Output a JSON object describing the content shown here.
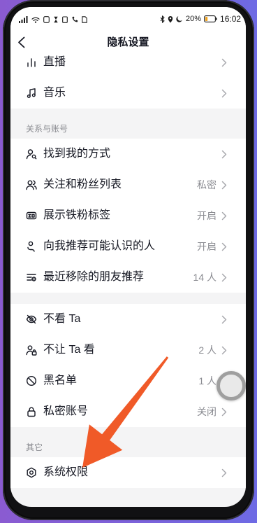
{
  "status_bar": {
    "battery": "20%",
    "time": "16:02",
    "icons_left": [
      "signal-icon",
      "wifi-icon",
      "message-icon",
      "hourglass-icon",
      "clipboard-icon",
      "call-icon",
      "sim-icon"
    ],
    "icons_right": [
      "bluetooth-icon",
      "location-icon",
      "moon-icon",
      "battery-icon"
    ]
  },
  "header": {
    "title": "隐私设置",
    "back_icon": "chevron-left-icon"
  },
  "groups": [
    {
      "items": [
        {
          "label": "直播",
          "icon": "live-bars-icon"
        },
        {
          "label": "音乐",
          "icon": "music-note-icon"
        }
      ]
    },
    {
      "header": "关系与账号",
      "items": [
        {
          "label": "找到我的方式",
          "icon": "person-search-icon"
        },
        {
          "label": "关注和粉丝列表",
          "value": "私密",
          "icon": "two-people-icon"
        },
        {
          "label": "展示铁粉标签",
          "value": "开启",
          "icon": "fan-badge-icon"
        },
        {
          "label": "向我推荐可能认识的人",
          "value": "开启",
          "icon": "recommend-person-icon"
        },
        {
          "label": "最近移除的朋友推荐",
          "value": "14 人",
          "icon": "removed-list-icon"
        }
      ]
    },
    {
      "items": [
        {
          "label": "不看 Ta",
          "icon": "eye-off-icon"
        },
        {
          "label": "不让 Ta 看",
          "value": "2 人",
          "icon": "person-lock-icon"
        },
        {
          "label": "黑名单",
          "value": "1 人",
          "icon": "block-icon"
        },
        {
          "label": "私密账号",
          "value": "关闭",
          "icon": "lock-icon"
        }
      ]
    },
    {
      "header": "其它",
      "items": [
        {
          "label": "系统权限",
          "icon": "hexagon-settings-icon"
        }
      ]
    }
  ],
  "floating_ball": {
    "icon": "assistive-ball-icon"
  },
  "annotation": {
    "icon": "arrow-annotation-icon",
    "color": "#f05a28"
  },
  "colors": {
    "text": "#161823",
    "secondary": "#8a8b91",
    "page_background": "#f4f4f5",
    "battery_fill": "#f0a21d"
  }
}
